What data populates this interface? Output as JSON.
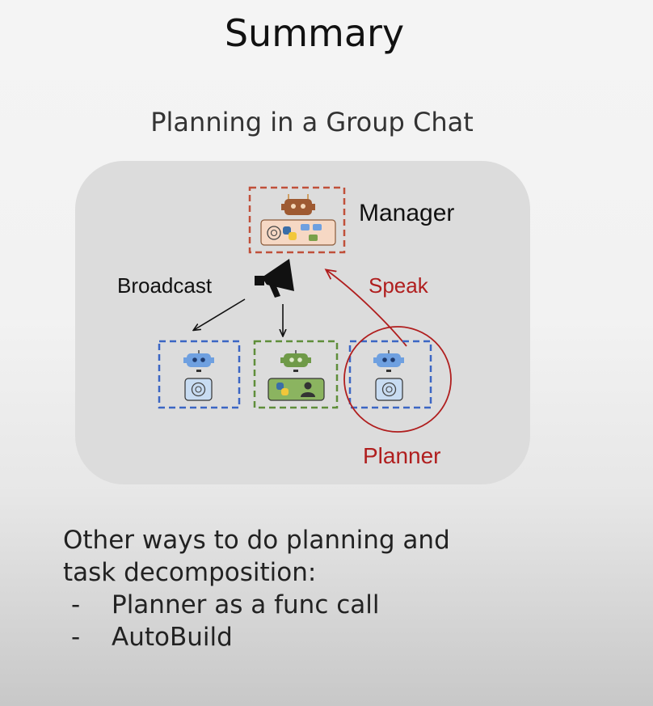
{
  "slide": {
    "title": "Summary",
    "subtitle": "Planning in a Group Chat"
  },
  "diagram": {
    "manager_label": "Manager",
    "broadcast_label": "Broadcast",
    "speak_label": "Speak",
    "planner_label": "Planner",
    "colors": {
      "manager_box": "#c0503a",
      "agent_blue": "#3b66c4",
      "agent_green": "#5f8e3a",
      "highlight_red": "#b01e1e"
    }
  },
  "notes": {
    "heading_line1": "Other ways to do planning and",
    "heading_line2": "task decomposition:",
    "items": [
      {
        "dash": "-",
        "text": "Planner as a func call"
      },
      {
        "dash": "-",
        "text": "AutoBuild"
      }
    ]
  }
}
